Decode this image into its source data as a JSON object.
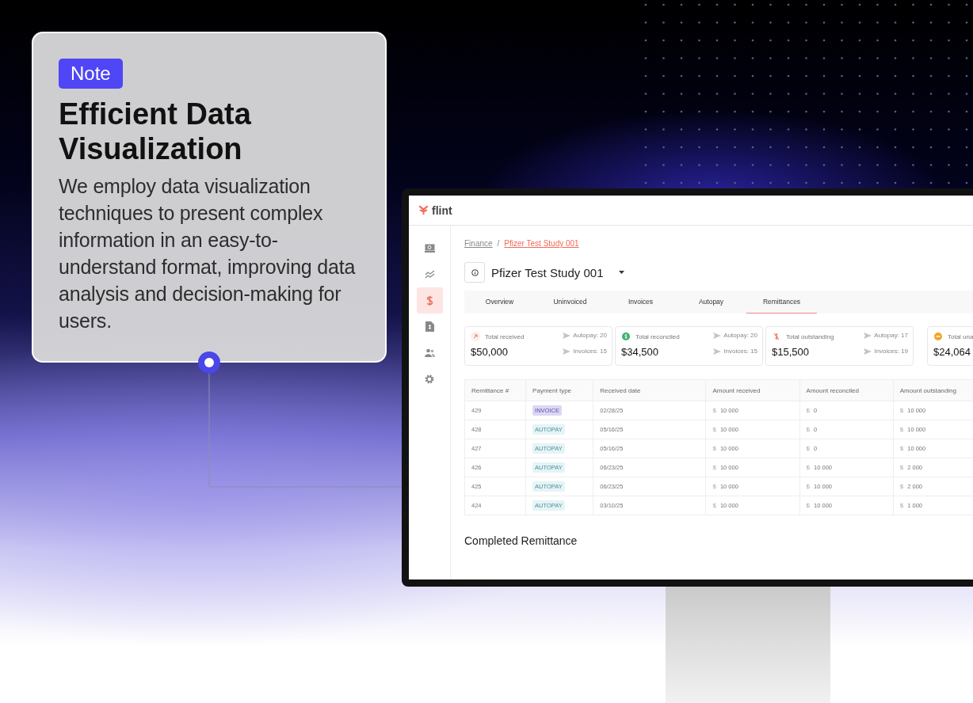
{
  "note": {
    "badge": "Note",
    "title": "Efficient Data Visualization",
    "body": "We employ data visualization techniques to present complex information in an easy-to-understand format, improving data analysis and decision-making for users."
  },
  "app": {
    "logo": "flint",
    "sidebar": [
      {
        "kind": "search",
        "selected": false
      },
      {
        "kind": "chart",
        "selected": false
      },
      {
        "kind": "dollar",
        "selected": true
      },
      {
        "kind": "document",
        "selected": false
      },
      {
        "kind": "users",
        "selected": false
      },
      {
        "kind": "settings",
        "selected": false
      }
    ],
    "breadcrumb": [
      {
        "label": "Finance",
        "selected": false
      },
      {
        "separator": "/",
        "label": "Pfizer Test Study 001",
        "selected": true
      }
    ],
    "study_title": "Pfizer Test Study 001",
    "tabs": [
      {
        "label": "Overview",
        "selected": false
      },
      {
        "label": "Uninvoiced",
        "selected": false
      },
      {
        "label": "Invoices",
        "selected": false
      },
      {
        "label": "Autopay",
        "selected": false
      },
      {
        "label": "Remittances",
        "selected": true
      }
    ],
    "stats": [
      {
        "kind": "received",
        "label": "Total received",
        "value": "$50,000",
        "autopay": "Autopay: 20",
        "invoices": "Invoices: 15"
      },
      {
        "kind": "reconciled",
        "label": "Total reconciled",
        "value": "$34,500",
        "autopay": "Autopay: 20",
        "invoices": "Invoices: 15"
      },
      {
        "kind": "outstanding",
        "label": "Total outstanding",
        "value": "$15,500",
        "autopay": "Autopay: 17",
        "invoices": "Invoices: 19"
      },
      {
        "kind": "unapplied",
        "label": "Total una",
        "value": "$24,064"
      }
    ],
    "table": {
      "columns": [
        "Remittance #",
        "Payment type",
        "Received date",
        "Amount received",
        "Amount reconciled",
        "Amount outstanding"
      ],
      "rows": [
        {
          "number": "429",
          "type": {
            "kind": "invoice",
            "label": "INVOICE"
          },
          "date": "02/28/25",
          "amounts": [
            {
              "currency": "$",
              "value": "10 000"
            },
            {
              "currency": "$",
              "value": "0"
            },
            {
              "currency": "$",
              "value": "10 000"
            }
          ]
        },
        {
          "number": "428",
          "type": {
            "kind": "autopay",
            "label": "AUTOPAY"
          },
          "date": "05/16/25",
          "amounts": [
            {
              "currency": "$",
              "value": "10 000"
            },
            {
              "currency": "$",
              "value": "0"
            },
            {
              "currency": "$",
              "value": "10 000"
            }
          ]
        },
        {
          "number": "427",
          "type": {
            "kind": "autopay",
            "label": "AUTOPAY"
          },
          "date": "05/16/25",
          "amounts": [
            {
              "currency": "$",
              "value": "10 000"
            },
            {
              "currency": "$",
              "value": "0"
            },
            {
              "currency": "$",
              "value": "10 000"
            }
          ]
        },
        {
          "number": "426",
          "type": {
            "kind": "autopay",
            "label": "AUTOPAY"
          },
          "date": "06/23/25",
          "amounts": [
            {
              "currency": "$",
              "value": "10 000"
            },
            {
              "currency": "$",
              "value": "10 000"
            },
            {
              "currency": "$",
              "value": "2 000"
            }
          ]
        },
        {
          "number": "425",
          "type": {
            "kind": "autopay",
            "label": "AUTOPAY"
          },
          "date": "06/23/25",
          "amounts": [
            {
              "currency": "$",
              "value": "10 000"
            },
            {
              "currency": "$",
              "value": "10 000"
            },
            {
              "currency": "$",
              "value": "2 000"
            }
          ]
        },
        {
          "number": "424",
          "type": {
            "kind": "autopay",
            "label": "AUTOPAY"
          },
          "date": "03/10/25",
          "amounts": [
            {
              "currency": "$",
              "value": "10 000"
            },
            {
              "currency": "$",
              "value": "10 000"
            },
            {
              "currency": "$",
              "value": "1 000"
            }
          ]
        }
      ]
    },
    "section_title": "Completed Remittance"
  }
}
